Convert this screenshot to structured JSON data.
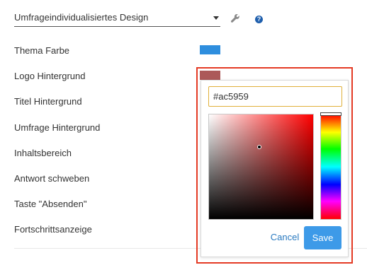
{
  "theme_select": {
    "value": "Umfrageindividualisiertes Design"
  },
  "rows": [
    {
      "label": "Thema Farbe",
      "color": "#2e8ede"
    },
    {
      "label": "Logo Hintergrund",
      "color": "#ac5959"
    },
    {
      "label": "Titel Hintergrund"
    },
    {
      "label": "Umfrage Hintergrund"
    },
    {
      "label": "Inhaltsbereich"
    },
    {
      "label": "Antwort schweben"
    },
    {
      "label": "Taste \"Absenden\""
    },
    {
      "label": "Fortschrittsanzeige"
    }
  ],
  "color_picker": {
    "hex_value": "#ac5959",
    "hue_color": "#ff0000",
    "cancel_label": "Cancel",
    "save_label": "Save"
  },
  "icons": {
    "tool": "wrench-icon",
    "help": "help-icon",
    "help_glyph": "?"
  },
  "colors": {
    "accent": "#3d9ae8",
    "highlight_outline": "#e43a24",
    "input_border": "#e0b03a"
  }
}
